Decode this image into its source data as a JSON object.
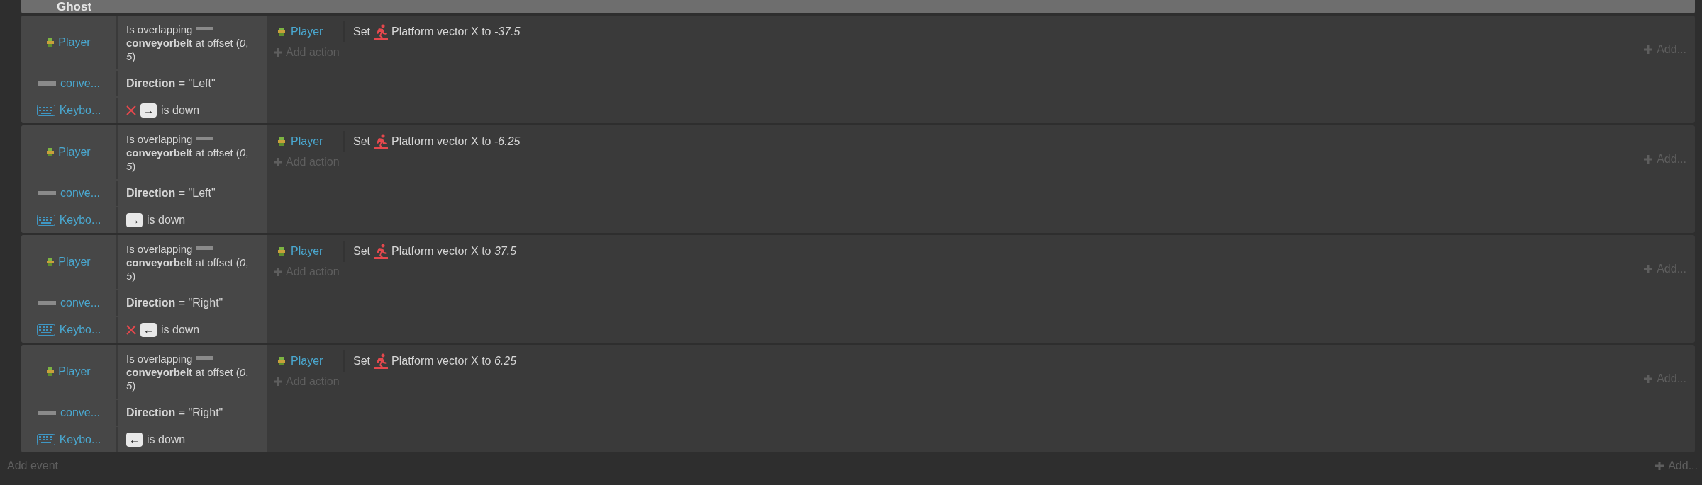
{
  "group": {
    "title": "Ghost"
  },
  "events": [
    {
      "conditions": [
        {
          "object": {
            "name": "Player"
          },
          "kind": "overlap",
          "before": "Is overlapping",
          "text": "**conveyorbelt** at offset (*0*, *5*)"
        },
        {
          "object": {
            "name": "conve..."
          },
          "kind": "compare",
          "text": "**Direction** = \"Left\""
        },
        {
          "object": {
            "name": "Keybo..."
          },
          "kind": "key",
          "inverted": true,
          "key": "→",
          "text": "is down"
        }
      ],
      "actions": [
        {
          "object": "Player",
          "verb": "Set",
          "text": "Platform vector X to *-37.5*"
        }
      ],
      "add_action": "Add action",
      "add": "Add..."
    },
    {
      "conditions": [
        {
          "object": {
            "name": "Player"
          },
          "kind": "overlap",
          "before": "Is overlapping",
          "text": "**conveyorbelt** at offset (*0*, *5*)"
        },
        {
          "object": {
            "name": "conve..."
          },
          "kind": "compare",
          "text": "**Direction** = \"Left\""
        },
        {
          "object": {
            "name": "Keybo..."
          },
          "kind": "key",
          "inverted": false,
          "key": "→",
          "text": "is down"
        }
      ],
      "actions": [
        {
          "object": "Player",
          "verb": "Set",
          "text": "Platform vector X to *-6.25*"
        }
      ],
      "add_action": "Add action",
      "add": "Add..."
    },
    {
      "conditions": [
        {
          "object": {
            "name": "Player"
          },
          "kind": "overlap",
          "before": "Is overlapping",
          "text": "**conveyorbelt** at offset (*0*, *5*)"
        },
        {
          "object": {
            "name": "conve..."
          },
          "kind": "compare",
          "text": "**Direction** = \"Right\""
        },
        {
          "object": {
            "name": "Keybo..."
          },
          "kind": "key",
          "inverted": true,
          "key": "←",
          "text": "is down"
        }
      ],
      "actions": [
        {
          "object": "Player",
          "verb": "Set",
          "text": "Platform vector X to *37.5*"
        }
      ],
      "add_action": "Add action",
      "add": "Add..."
    },
    {
      "conditions": [
        {
          "object": {
            "name": "Player"
          },
          "kind": "overlap",
          "before": "Is overlapping",
          "text": "**conveyorbelt** at offset (*0*, *5*)"
        },
        {
          "object": {
            "name": "conve..."
          },
          "kind": "compare",
          "text": "**Direction** = \"Right\""
        },
        {
          "object": {
            "name": "Keybo..."
          },
          "kind": "key",
          "inverted": false,
          "key": "←",
          "text": "is down"
        }
      ],
      "actions": [
        {
          "object": "Player",
          "verb": "Set",
          "text": "Platform vector X to *6.25*"
        }
      ],
      "add_action": "Add action",
      "add": "Add..."
    }
  ],
  "add_event": "Add event",
  "add": "Add..."
}
